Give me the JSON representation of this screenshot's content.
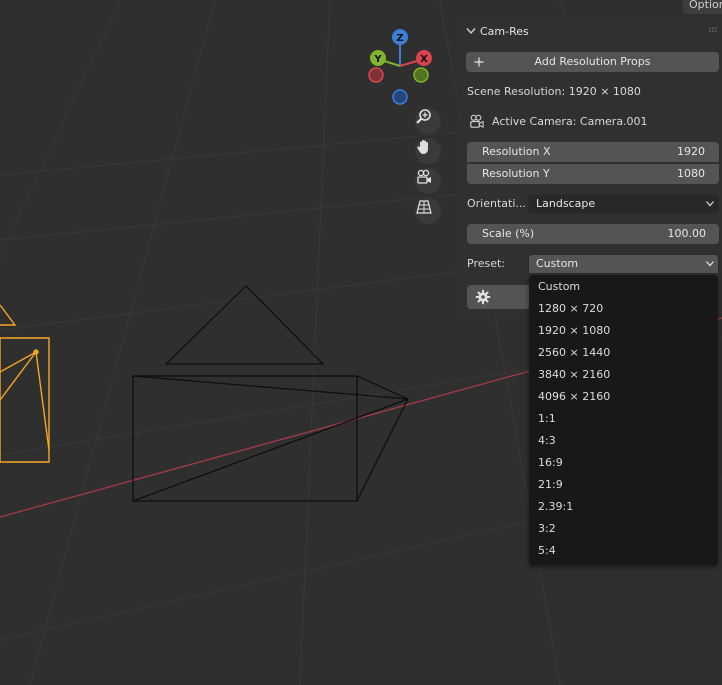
{
  "header": {
    "options_label": "Option"
  },
  "gizmo": {
    "z": "Z",
    "y": "Y",
    "x": "X"
  },
  "panel": {
    "title": "Cam-Res",
    "add_button": "Add Resolution Props",
    "scene_resolution": "Scene Resolution: 1920 × 1080",
    "active_camera": "Active Camera: Camera.001",
    "res_x_label": "Resolution X",
    "res_x_value": "1920",
    "res_y_label": "Resolution Y",
    "res_y_value": "1080",
    "orientation_label": "Orientati...",
    "orientation_value": "Landscape",
    "scale_label": "Scale (%)",
    "scale_value": "100.00",
    "preset_label": "Preset:",
    "preset_value": "Custom"
  },
  "preset_options": [
    "Custom",
    "1280 × 720",
    "1920 × 1080",
    "2560 × 1440",
    "3840 × 2160",
    "4096 × 2160",
    "1:1",
    "4:3",
    "16:9",
    "21:9",
    "2.39:1",
    "3:2",
    "5:4"
  ],
  "colors": {
    "viewport_bg": "#2f2f2f",
    "grid_line": "#3a3a3a",
    "x_axis": "#9b3a45",
    "selected_orange": "#f5a623",
    "axis_x": "#d9434f",
    "axis_y": "#7fb42b",
    "axis_z": "#3b7fd9"
  }
}
